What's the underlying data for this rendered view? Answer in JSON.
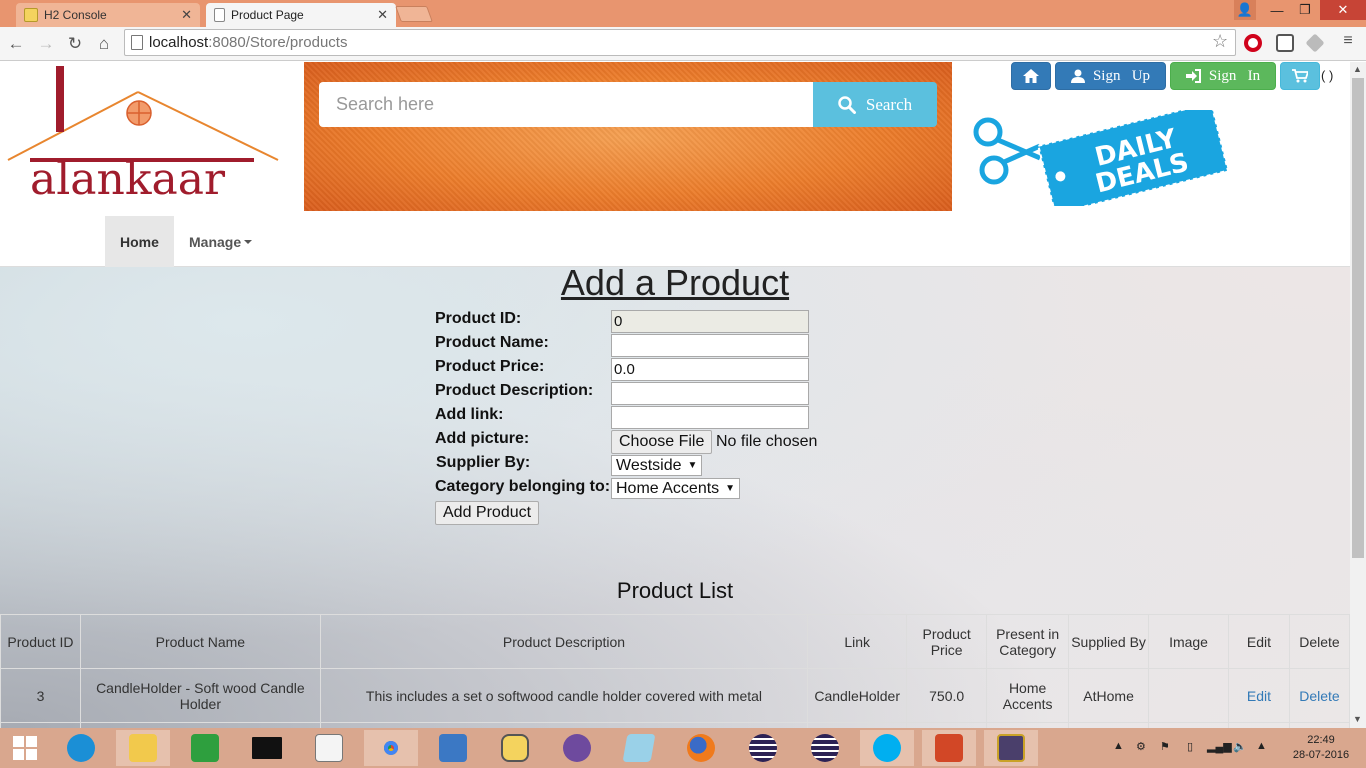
{
  "browser": {
    "tabs": [
      {
        "title": "H2 Console",
        "active": false
      },
      {
        "title": "Product Page",
        "active": true
      }
    ],
    "address_host": "localhost",
    "address_path": ":8080/Store/products"
  },
  "header": {
    "logo_text": "alankaar",
    "search_placeholder": "Search here",
    "search_button": "Search",
    "signup_label": "Sign   Up",
    "signin_label": "Sign   In",
    "cart_count": "( )",
    "deals_text_line1": "DAILY",
    "deals_text_line2": "DEALS"
  },
  "nav": {
    "home": "Home",
    "manage": "Manage"
  },
  "form": {
    "title": "Add a Product",
    "labels": {
      "id": "Product ID:",
      "name": "Product Name:",
      "price": "Product Price:",
      "description": "Product Description:",
      "link": "Add link:",
      "picture": "Add picture:",
      "supplier": "Supplier By:",
      "category": "Category belonging to:"
    },
    "values": {
      "id": "0",
      "name": "",
      "price": "0.0",
      "description": "",
      "link": ""
    },
    "file_button": "Choose File",
    "file_status": "No file chosen",
    "supplier_selected": "Westside",
    "category_selected": "Home Accents",
    "submit": "Add Product"
  },
  "list": {
    "title": "Product List",
    "columns": [
      "Product ID",
      "Product Name",
      "Product Description",
      "Link",
      "Product Price",
      "Present in Category",
      "Supplied By",
      "Image",
      "Edit",
      "Delete"
    ],
    "rows": [
      {
        "id": "3",
        "name": "CandleHolder - Soft wood Candle Holder",
        "description": "This includes a set o softwood candle holder covered with metal",
        "link": "CandleHolder",
        "price": "750.0",
        "category": "Home Accents",
        "supplier": "AtHome",
        "image": "",
        "edit": "Edit",
        "delete": "Delete"
      }
    ]
  },
  "taskbar": {
    "time": "22:49",
    "date": "28-07-2016"
  },
  "colors": {
    "primary": "#337ab7",
    "success": "#5cb85c",
    "info": "#5bc0de",
    "logo": "#a01c2c",
    "banner": "#ec7d2b",
    "titlebar": "#e8956f"
  }
}
